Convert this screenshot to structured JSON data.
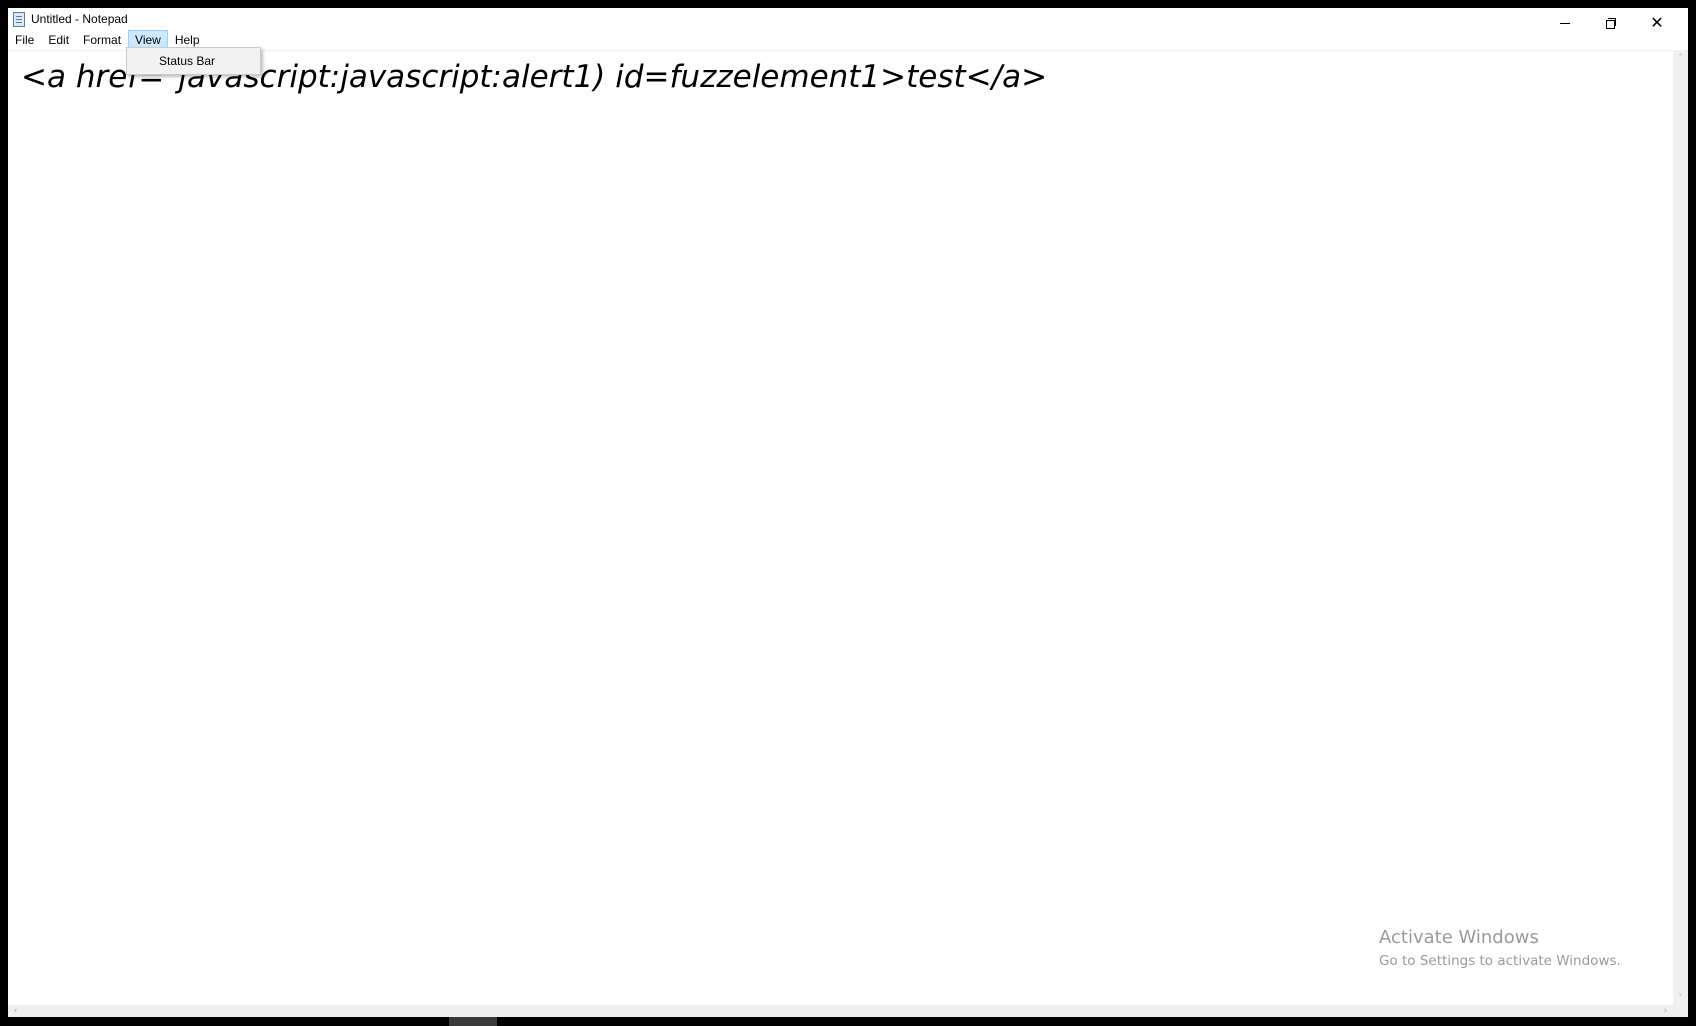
{
  "window": {
    "title": "Untitled - Notepad",
    "controls": {
      "minimize_icon": "minimize-icon",
      "restore_icon": "restore-icon",
      "close_icon": "close-icon",
      "close_glyph": "✕"
    }
  },
  "menubar": {
    "items": [
      {
        "label": "File"
      },
      {
        "label": "Edit"
      },
      {
        "label": "Format"
      },
      {
        "label": "View",
        "active": true
      },
      {
        "label": "Help"
      }
    ]
  },
  "view_menu": {
    "items": [
      {
        "label": "Status Bar"
      }
    ]
  },
  "editor": {
    "content": "<a href=\"javascript:javascript:alert1) id=fuzzelement1>test</a>"
  },
  "watermark": {
    "title": "Activate Windows",
    "subtitle": "Go to Settings to activate Windows."
  },
  "scrollbar": {
    "up_glyph": "˄",
    "down_glyph": "˅",
    "left_glyph": "‹",
    "right_glyph": "›"
  },
  "colors": {
    "menu_active_bg": "#cce8ff",
    "menu_active_border": "#99d1ff",
    "watermark": "#9a9a9a"
  }
}
